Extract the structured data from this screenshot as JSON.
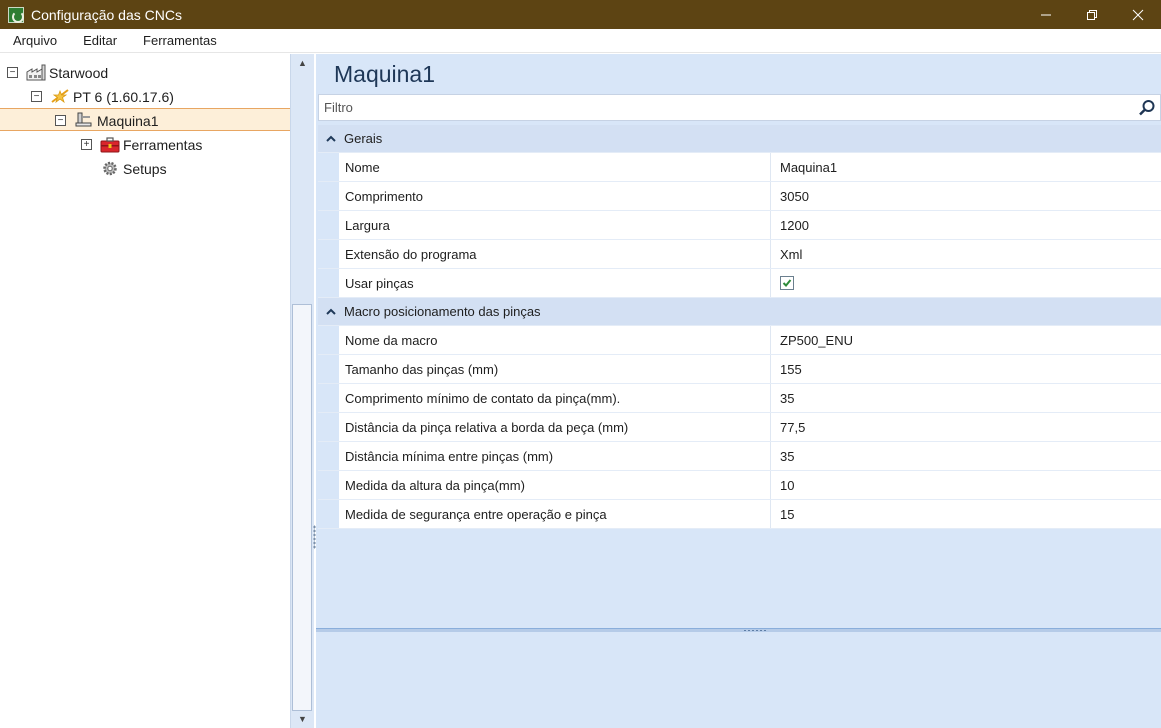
{
  "window": {
    "title": "Configuração das CNCs",
    "controls": {
      "minimize": "—",
      "maximize": "❐",
      "close": "✕"
    }
  },
  "menu": [
    "Arquivo",
    "Editar",
    "Ferramentas"
  ],
  "tree": {
    "root": "Starwood",
    "group": "PT 6 (1.60.17.6)",
    "machine": "Maquina1",
    "tools": "Ferramentas",
    "setups": "Setups"
  },
  "detail": {
    "title": "Maquina1",
    "filter_placeholder": "Filtro",
    "categories": [
      {
        "label": "Gerais",
        "rows": [
          {
            "name": "Nome",
            "value": "Maquina1"
          },
          {
            "name": "Comprimento",
            "value": "3050"
          },
          {
            "name": "Largura",
            "value": "1200"
          },
          {
            "name": "Extensão do programa",
            "value": "Xml"
          },
          {
            "name": "Usar pinças",
            "value": "",
            "checked": true
          }
        ]
      },
      {
        "label": "Macro posicionamento das pinças",
        "rows": [
          {
            "name": "Nome da macro",
            "value": "ZP500_ENU"
          },
          {
            "name": "Tamanho das pinças (mm)",
            "value": "155"
          },
          {
            "name": "Comprimento mínimo de contato da pinça(mm).",
            "value": "35"
          },
          {
            "name": "Distância da pinça relativa a borda da peça (mm)",
            "value": "77,5"
          },
          {
            "name": "Distância mínima entre pinças (mm)",
            "value": "35"
          },
          {
            "name": "Medida da altura da pinça(mm)",
            "value": "10"
          },
          {
            "name": "Medida de segurança entre operação e pinça",
            "value": "15"
          }
        ]
      }
    ]
  },
  "colors": {
    "titlebar": "#5d4413",
    "panel": "#d8e6f8",
    "selection": "#fdefd9",
    "selection_border": "#e8a662",
    "checkmark": "#2e8b3a"
  }
}
